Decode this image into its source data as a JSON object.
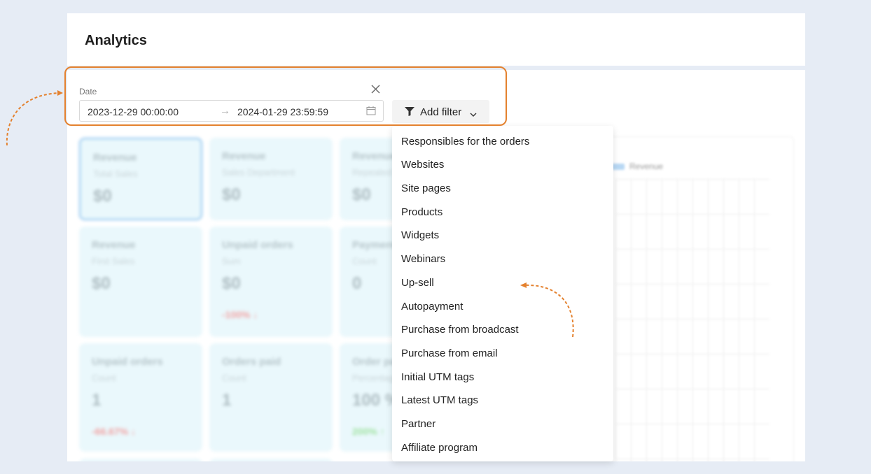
{
  "header": {
    "title": "Analytics"
  },
  "date_filter": {
    "label": "Date",
    "start": "2023-12-29 00:00:00",
    "arrow": "→",
    "end": "2024-01-29 23:59:59",
    "clear_icon": "close-icon",
    "calendar_icon": "calendar-icon"
  },
  "add_filter": {
    "label": "Add filter",
    "icon": "filter-icon",
    "chevron": "chevron-down-icon"
  },
  "cards": [
    {
      "title": "Revenue",
      "sub": "Total Sales",
      "value": "$0",
      "delta": ""
    },
    {
      "title": "Revenue",
      "sub": "Sales Department",
      "value": "$0",
      "delta": ""
    },
    {
      "title": "Revenue",
      "sub": "Repeated",
      "value": "$0",
      "delta": ""
    },
    {
      "title": "Revenue",
      "sub": "First Sales",
      "value": "$0",
      "delta": ""
    },
    {
      "title": "Unpaid orders",
      "sub": "Sum",
      "value": "$0",
      "delta": "-100% ↓"
    },
    {
      "title": "Payments",
      "sub": "Count",
      "value": "0",
      "delta": ""
    },
    {
      "title": "Unpaid orders",
      "sub": "Count",
      "value": "1",
      "delta": "-66.67% ↓"
    },
    {
      "title": "Orders paid",
      "sub": "Count",
      "value": "1",
      "delta": ""
    },
    {
      "title": "Order paid",
      "sub": "Percentage",
      "value": "100 %",
      "delta": "200% ↑"
    }
  ],
  "chart": {
    "legend": "Revenue"
  },
  "dropdown": {
    "items": [
      "Responsibles for the orders",
      "Websites",
      "Site pages",
      "Products",
      "Widgets",
      "Webinars",
      "Up-sell",
      "Autopayment",
      "Purchase from broadcast",
      "Purchase from email",
      "Initial UTM tags",
      "Latest UTM tags",
      "Partner",
      "Affiliate program"
    ]
  },
  "colors": {
    "accent": "#e4812e",
    "background": "#e6ecf5",
    "card": "#eaf8fc"
  }
}
